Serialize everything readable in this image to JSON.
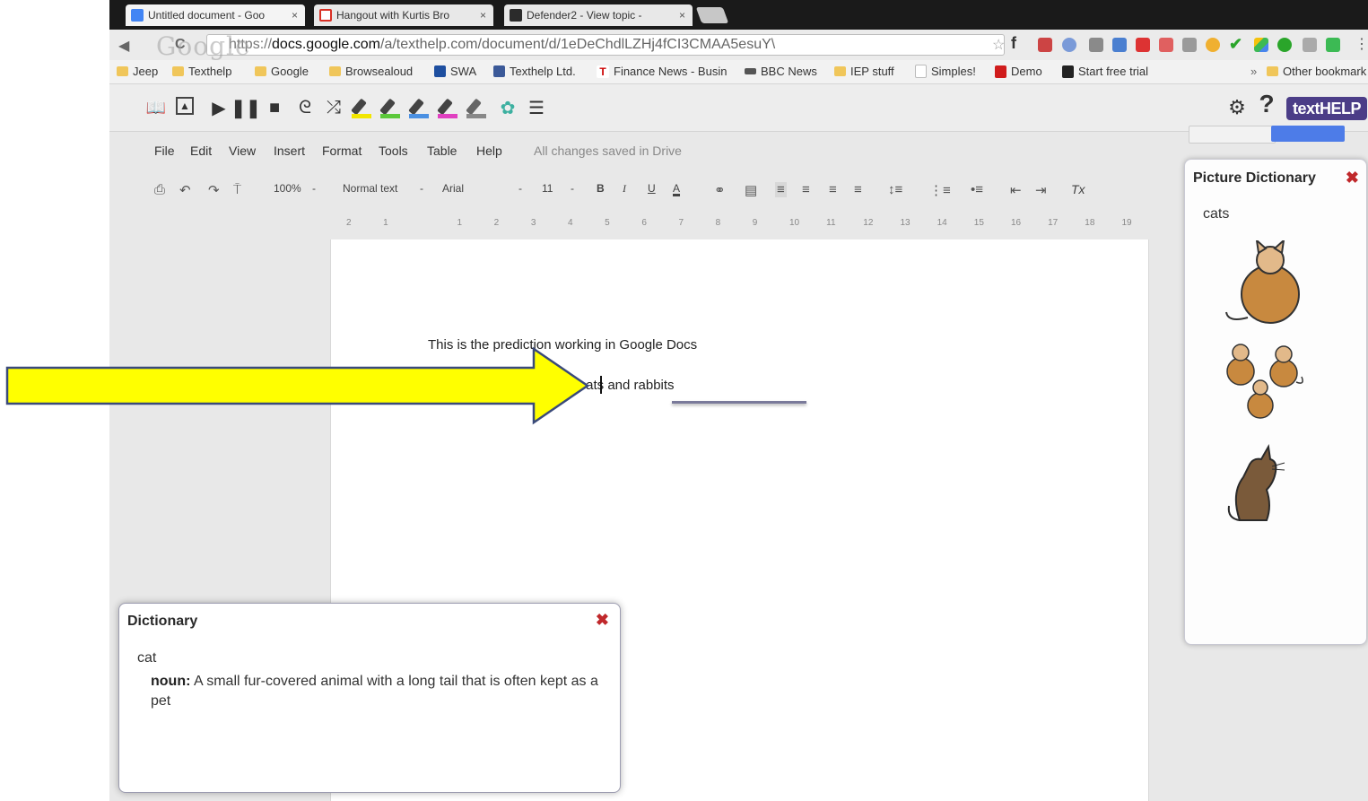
{
  "browser": {
    "tabs": [
      {
        "label": "Untitled document - Goo",
        "favicon": "google-docs-icon",
        "color": "#4285f4",
        "active": true
      },
      {
        "label": "Hangout with Kurtis Bro",
        "favicon": "gmail-icon",
        "color": "#d93025",
        "active": false
      },
      {
        "label": "Defender2 - View topic -",
        "favicon": "forum-icon",
        "color": "#2b2b2b",
        "active": false
      }
    ],
    "tab_close": "×",
    "url_scheme": "https://",
    "url_domain": "docs.google.com",
    "url_path": "/a/texthelp.com/document/d/1eDeChdlLZHj4fCI3CMAA5esuY\\",
    "watermark": "Google",
    "reload_icon": "C",
    "bookmarks": [
      {
        "label": "Jeep",
        "icon": "folder-icon"
      },
      {
        "label": "Texthelp",
        "icon": "folder-icon"
      },
      {
        "label": "Google",
        "icon": "folder-icon"
      },
      {
        "label": "Browsealoud",
        "icon": "folder-icon"
      },
      {
        "label": "SWA",
        "icon": "th-icon"
      },
      {
        "label": "Texthelp Ltd.",
        "icon": "facebook-icon"
      },
      {
        "label": "Finance News - Busin",
        "icon": "telegraph-icon"
      },
      {
        "label": "BBC News",
        "icon": "bbc-icon"
      },
      {
        "label": "IEP stuff",
        "icon": "folder-icon"
      },
      {
        "label": "Simples!",
        "icon": "page-icon"
      },
      {
        "label": "Demo",
        "icon": "red-square-icon"
      },
      {
        "label": "Start free trial",
        "icon": "cap-icon"
      }
    ],
    "bookmarks_more": "»",
    "other_bookmarks": "Other bookmark"
  },
  "texthelp": {
    "logo": "textHELP",
    "settings_icon": "gear-icon",
    "help_label": "?",
    "highlighter_colors": [
      "#f2e600",
      "#5cc83b",
      "#4a90e2",
      "#e040c0"
    ]
  },
  "docs": {
    "menus": [
      "File",
      "Edit",
      "View",
      "Insert",
      "Format",
      "Tools",
      "Table",
      "Help"
    ],
    "saved_status": "All changes saved in Drive",
    "zoom": "100%",
    "style": "Normal text",
    "font": "Arial",
    "font_size": "11",
    "bold": "B",
    "italic": "I",
    "underline": "U",
    "text_color": "A",
    "clear_format": "Tx",
    "ruler_ticks": [
      "2",
      "1",
      "",
      "1",
      "2",
      "3",
      "4",
      "5",
      "6",
      "7",
      "8",
      "9",
      "10",
      "11",
      "12",
      "13",
      "14",
      "15",
      "16",
      "17",
      "18",
      "19"
    ],
    "line1": "This is the prediction working in Google Docs",
    "line2": "s cats and rabbits"
  },
  "picture_dictionary": {
    "title": "Picture Dictionary",
    "word": "cats",
    "close_icon": "red-x-icon"
  },
  "dictionary": {
    "title": "Dictionary",
    "word": "cat",
    "pos": "noun:",
    "definition": " A small fur-covered animal with a long tail that is often kept as a pet",
    "close_icon": "red-x-icon"
  },
  "colors": {
    "arrow_fill": "#ffff00",
    "arrow_stroke": "#3a4a7a",
    "close_red": "#c0282b",
    "cat_fill": "#c8893f",
    "cat_dark": "#7a5a3a"
  }
}
